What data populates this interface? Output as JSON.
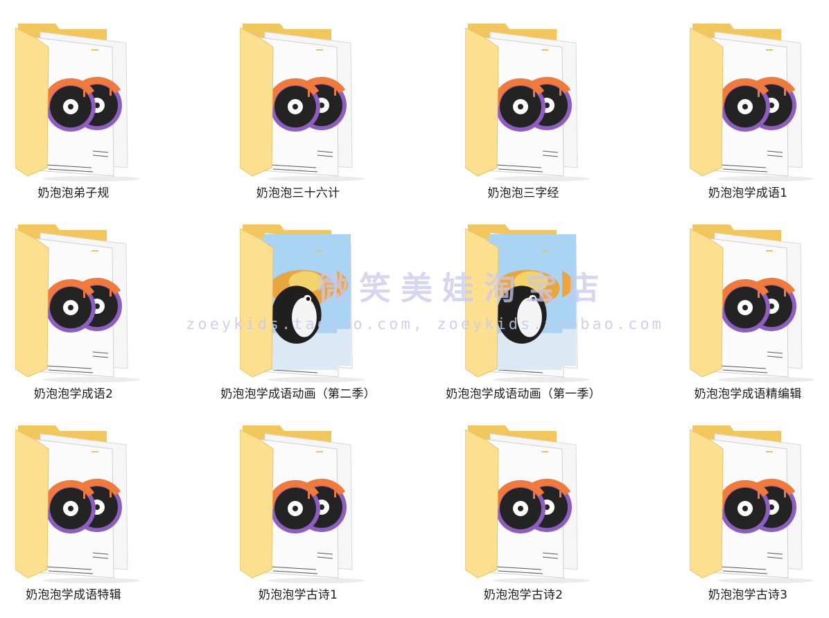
{
  "folders": [
    {
      "name": "奶泡泡弟子规",
      "thumbnail": "disc-icon"
    },
    {
      "name": "奶泡泡三十六计",
      "thumbnail": "disc-icon"
    },
    {
      "name": "奶泡泡三字经",
      "thumbnail": "disc-icon"
    },
    {
      "name": "奶泡泡学成语1",
      "thumbnail": "disc-icon"
    },
    {
      "name": "奶泡泡学成语2",
      "thumbnail": "disc-icon"
    },
    {
      "name": "奶泡泡学成语动画（第二季）",
      "thumbnail": "cartoon-preview"
    },
    {
      "name": "奶泡泡学成语动画（第一季）",
      "thumbnail": "cartoon-preview"
    },
    {
      "name": "奶泡泡学成语精编辑",
      "thumbnail": "disc-icon"
    },
    {
      "name": "奶泡泡学成语特辑",
      "thumbnail": "disc-icon"
    },
    {
      "name": "奶泡泡学古诗1",
      "thumbnail": "disc-icon"
    },
    {
      "name": "奶泡泡学古诗2",
      "thumbnail": "disc-icon"
    },
    {
      "name": "奶泡泡学古诗3",
      "thumbnail": "disc-icon"
    }
  ],
  "watermark": {
    "text": "微笑美娃淘宝店",
    "url": "zoeykids.taobao.com, zoeykids.taobao.com"
  },
  "colors": {
    "folder_back": "#f1c65c",
    "folder_front": "#fde08f",
    "disc_dark": "#232323",
    "disc_orange": "#f07a3c",
    "disc_purple": "#8d5dbf",
    "sky_blue": "#a9d4f3"
  }
}
